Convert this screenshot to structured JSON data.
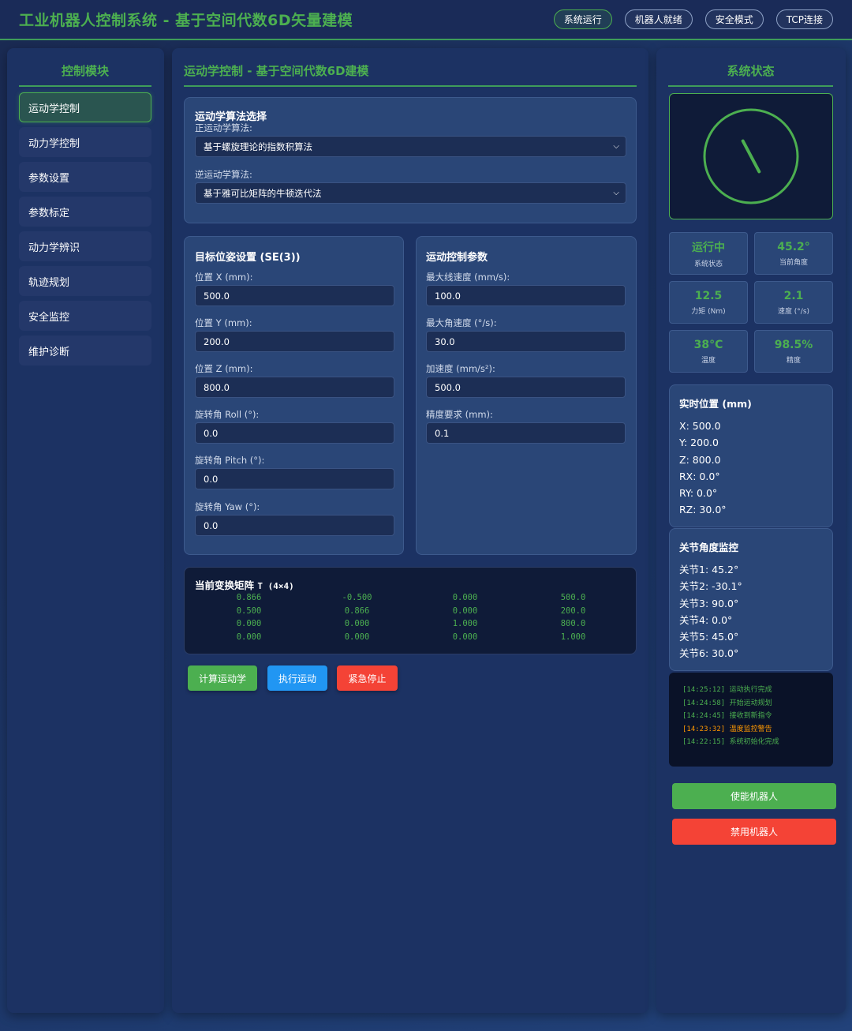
{
  "header": {
    "title": "工业机器人控制系统 - 基于空间代数6D矢量建模",
    "pills": [
      "系统运行",
      "机器人就绪",
      "安全模式",
      "TCP连接"
    ]
  },
  "sidebar": {
    "title": "控制模块",
    "items": [
      "运动学控制",
      "动力学控制",
      "参数设置",
      "参数标定",
      "动力学辨识",
      "轨迹规划",
      "安全监控",
      "维护诊断"
    ],
    "active_index": 0
  },
  "main": {
    "title": "运动学控制 - 基于空间代数6D建模",
    "algorithm": {
      "title": "运动学算法选择",
      "forward_label": "正运动学算法:",
      "forward_value": "基于螺旋理论的指数积算法",
      "inverse_label": "逆运动学算法:",
      "inverse_value": "基于雅可比矩阵的牛顿迭代法"
    },
    "pose": {
      "title": "目标位姿设置 (SE(3))",
      "fields": [
        {
          "label": "位置 X (mm):",
          "value": "500.0"
        },
        {
          "label": "位置 Y (mm):",
          "value": "200.0"
        },
        {
          "label": "位置 Z (mm):",
          "value": "800.0"
        },
        {
          "label": "旋转角 Roll (°):",
          "value": "0.0"
        },
        {
          "label": "旋转角 Pitch (°):",
          "value": "0.0"
        },
        {
          "label": "旋转角 Yaw (°):",
          "value": "0.0"
        }
      ]
    },
    "motion": {
      "title": "运动控制参数",
      "fields": [
        {
          "label": "最大线速度 (mm/s):",
          "value": "100.0"
        },
        {
          "label": "最大角速度 (°/s):",
          "value": "30.0"
        },
        {
          "label": "加速度 (mm/s²):",
          "value": "500.0"
        },
        {
          "label": "精度要求 (mm):",
          "value": "0.1"
        }
      ]
    },
    "matrix": {
      "title": "当前变换矩阵",
      "symbol": "T (4×4)",
      "rows": [
        [
          "0.866",
          "-0.500",
          "0.000",
          "500.0"
        ],
        [
          "0.500",
          "0.866",
          "0.000",
          "200.0"
        ],
        [
          "0.000",
          "0.000",
          "1.000",
          "800.0"
        ],
        [
          "0.000",
          "0.000",
          "0.000",
          "1.000"
        ]
      ]
    },
    "buttons": {
      "compute": "计算运动学",
      "execute": "执行运动",
      "estop": "紧急停止"
    }
  },
  "right": {
    "title": "系统状态",
    "gauge_angle_deg": 45.2,
    "colors": {
      "accent": "#4caf50",
      "warning": "#ff9800",
      "danger": "#f44336",
      "info": "#2196f3"
    },
    "stats": [
      {
        "value": "运行中",
        "label": "系统状态"
      },
      {
        "value": "45.2°",
        "label": "当前角度"
      },
      {
        "value": "12.5",
        "label": "力矩 (Nm)"
      },
      {
        "value": "2.1",
        "label": "速度 (°/s)"
      },
      {
        "value": "38°C",
        "label": "温度"
      },
      {
        "value": "98.5%",
        "label": "精度"
      }
    ],
    "position": {
      "title": "实时位置 (mm)",
      "lines": [
        "X: 500.0",
        "Y: 200.0",
        "Z: 800.0",
        "RX: 0.0°",
        "RY: 0.0°",
        "RZ: 30.0°"
      ]
    },
    "joints": {
      "title": "关节角度监控",
      "lines": [
        "关节1: 45.2°",
        "关节2: -30.1°",
        "关节3: 90.0°",
        "关节4: 0.0°",
        "关节5: 45.0°",
        "关节6: 30.0°"
      ]
    },
    "log": [
      {
        "time": "[14:25:12]",
        "msg": "运动执行完成",
        "level": "info"
      },
      {
        "time": "[14:24:58]",
        "msg": "开始运动规划",
        "level": "info"
      },
      {
        "time": "[14:24:45]",
        "msg": "接收到新指令",
        "level": "info"
      },
      {
        "time": "[14:23:32]",
        "msg": "温度监控警告",
        "level": "warn"
      },
      {
        "time": "[14:22:15]",
        "msg": "系统初始化完成",
        "level": "info"
      }
    ],
    "enable_label": "使能机器人",
    "disable_label": "禁用机器人"
  }
}
